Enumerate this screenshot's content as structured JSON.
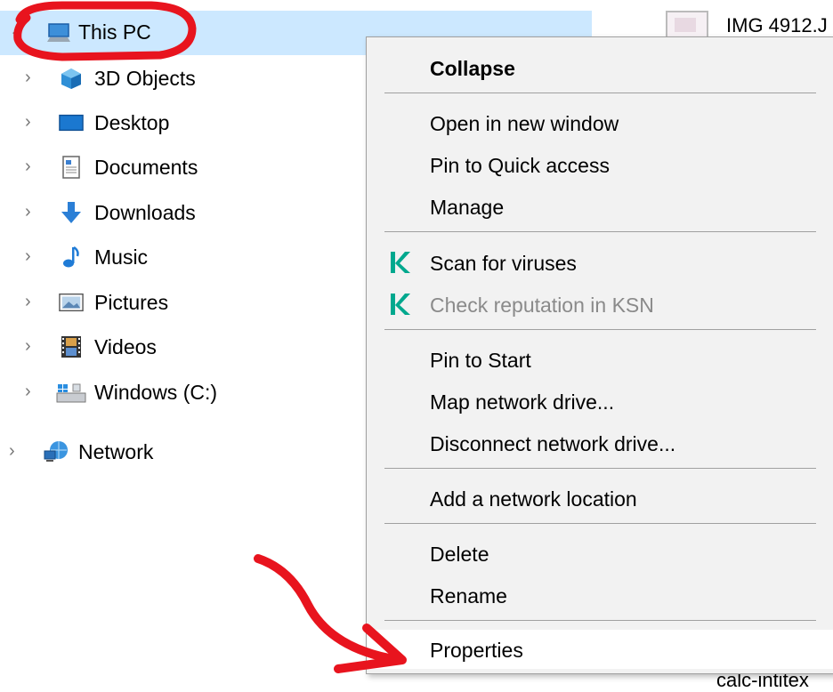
{
  "nav": {
    "items": [
      {
        "label": "This PC",
        "icon": "computer-icon"
      },
      {
        "label": "3D Objects",
        "icon": "3d-objects-icon"
      },
      {
        "label": "Desktop",
        "icon": "desktop-icon"
      },
      {
        "label": "Documents",
        "icon": "documents-icon"
      },
      {
        "label": "Downloads",
        "icon": "downloads-icon"
      },
      {
        "label": "Music",
        "icon": "music-icon"
      },
      {
        "label": "Pictures",
        "icon": "pictures-icon"
      },
      {
        "label": "Videos",
        "icon": "videos-icon"
      },
      {
        "label": "Windows (C:)",
        "icon": "drive-icon"
      },
      {
        "label": "Network",
        "icon": "network-icon"
      }
    ]
  },
  "content": {
    "file_top": "IMG 4912.J",
    "file_bottom": "calc-intitex"
  },
  "menu": {
    "items": [
      {
        "label": "Collapse"
      },
      {
        "label": "Open in new window"
      },
      {
        "label": "Pin to Quick access"
      },
      {
        "label": "Manage"
      },
      {
        "label": "Scan for viruses",
        "icon": "kaspersky-icon"
      },
      {
        "label": "Check reputation in KSN",
        "icon": "kaspersky-icon"
      },
      {
        "label": "Pin to Start"
      },
      {
        "label": "Map network drive..."
      },
      {
        "label": "Disconnect network drive..."
      },
      {
        "label": "Add a network location"
      },
      {
        "label": "Delete"
      },
      {
        "label": "Rename"
      },
      {
        "label": "Properties"
      }
    ]
  },
  "colors": {
    "selection": "#cce8ff",
    "annotation": "#e8141e",
    "kaspersky": "#00a88e"
  }
}
